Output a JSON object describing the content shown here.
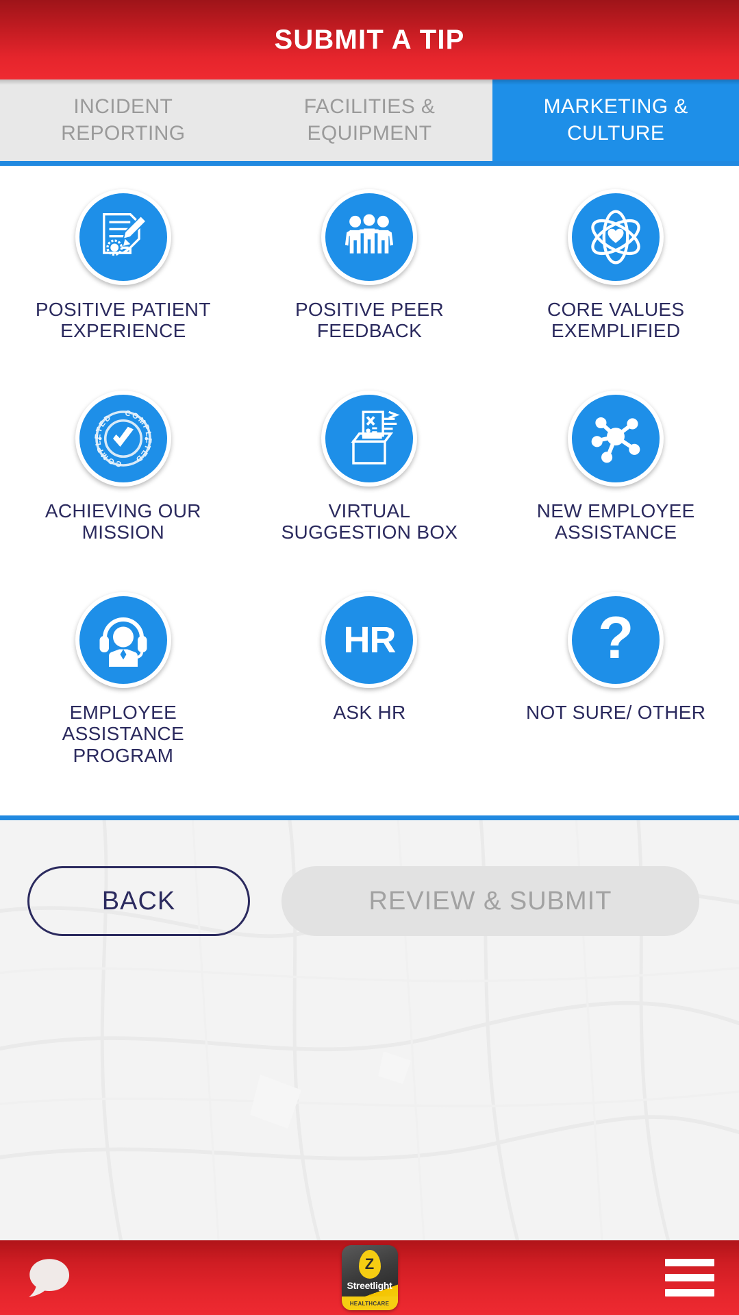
{
  "header": {
    "title": "SUBMIT A TIP"
  },
  "tabs": [
    {
      "label": "INCIDENT REPORTING",
      "line1": "INCIDENT",
      "line2": "REPORTING",
      "active": false
    },
    {
      "label": "FACILITIES & EQUIPMENT",
      "line1": "FACILITIES &",
      "line2": "EQUIPMENT",
      "active": false
    },
    {
      "label": "MARKETING & CULTURE",
      "line1": "MARKETING &",
      "line2": "CULTURE",
      "active": true
    }
  ],
  "categories": [
    {
      "label": "POSITIVE PATIENT EXPERIENCE",
      "icon": "document-pen-icon"
    },
    {
      "label": "POSITIVE PEER FEEDBACK",
      "icon": "three-people-icon"
    },
    {
      "label": "CORE VALUES EXEMPLIFIED",
      "icon": "atom-heart-icon"
    },
    {
      "label": "ACHIEVING OUR MISSION",
      "icon": "completed-stamp-icon"
    },
    {
      "label": "VIRTUAL SUGGESTION BOX",
      "icon": "suggestion-box-icon"
    },
    {
      "label": "NEW EMPLOYEE ASSISTANCE",
      "icon": "network-hub-icon"
    },
    {
      "label": "EMPLOYEE ASSISTANCE PROGRAM",
      "icon": "headset-agent-icon"
    },
    {
      "label": "ASK HR",
      "icon": "hr-text-icon",
      "text": "HR"
    },
    {
      "label": "NOT SURE/ OTHER",
      "icon": "question-mark-icon",
      "text": "?"
    }
  ],
  "actions": {
    "back_label": "BACK",
    "submit_label": "REVIEW & SUBMIT",
    "submit_disabled": true
  },
  "bottom_nav": {
    "chat_icon": "chat-bubble-icon",
    "menu_icon": "hamburger-menu-icon",
    "logo": {
      "mark": "Z",
      "name": "Streetlight",
      "sub": "HEALTHCARE"
    }
  },
  "colors": {
    "brand_red": "#e5252c",
    "brand_blue": "#1e8fe8",
    "label_navy": "#2b2a5e",
    "tab_inactive_bg": "#e8e8e8",
    "tab_inactive_text": "#9a9a9a",
    "disabled_button_bg": "#e2e2e2",
    "disabled_button_text": "#a2a2a2"
  }
}
